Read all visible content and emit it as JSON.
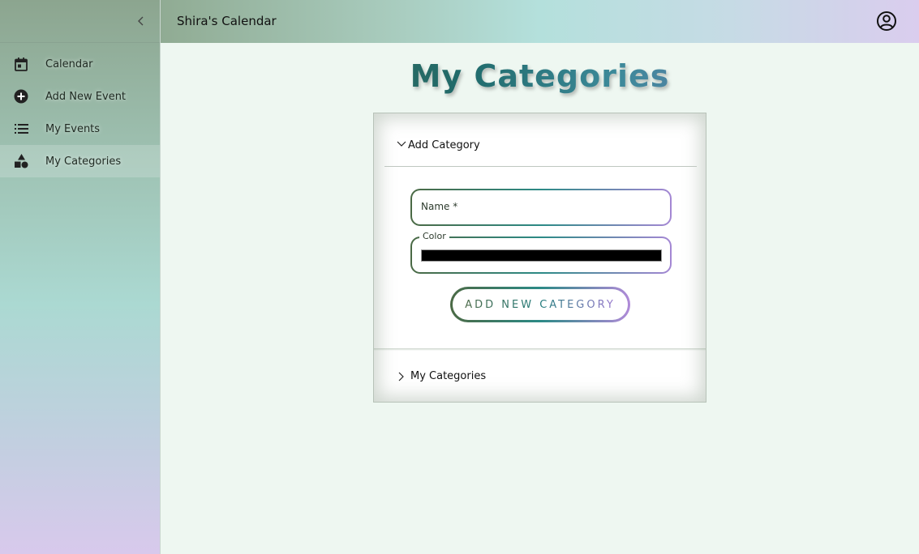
{
  "app": {
    "title": "Shira's Calendar"
  },
  "sidebar": {
    "items": [
      {
        "label": "Calendar",
        "icon": "calendar-icon"
      },
      {
        "label": "Add New Event",
        "icon": "add-circle-icon"
      },
      {
        "label": "My Events",
        "icon": "list-icon"
      },
      {
        "label": "My Categories",
        "icon": "category-icon",
        "active": true
      }
    ]
  },
  "page": {
    "title": "My Categories"
  },
  "add_category": {
    "header": "Add Category",
    "name_label": "Name *",
    "color_label": "Color",
    "color_value": "#000000",
    "button_label": "ADD NEW CATEGORY"
  },
  "my_categories": {
    "header": "My Categories"
  },
  "colors": {
    "accent_green": "#4b6a45",
    "accent_teal": "#2c8a86",
    "accent_purple": "#a487d4",
    "background": "#eef7f1"
  }
}
